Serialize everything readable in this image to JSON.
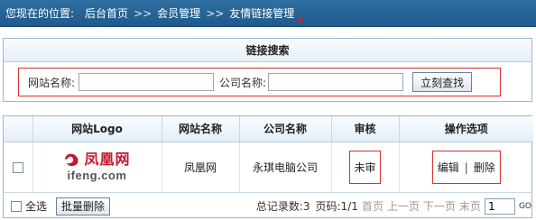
{
  "breadcrumb": {
    "prefix": "您现在的位置:",
    "items": [
      "后台首页",
      "会员管理",
      "友情链接管理"
    ],
    "separator": ">>"
  },
  "search": {
    "title": "链接搜索",
    "site_name_label": "网站名称:",
    "site_name_value": "",
    "company_label": "公司名称:",
    "company_value": "",
    "submit_label": "立刻查找"
  },
  "table": {
    "columns": [
      "网站Logo",
      "网站名称",
      "公司名称",
      "审核",
      "操作选项"
    ],
    "rows": [
      {
        "logo_cn": "凤凰网",
        "logo_en": "ifeng.com",
        "site_name": "凤凰网",
        "company": "永琪电脑公司",
        "audit": "未审",
        "edit_label": "编辑",
        "ops_separator": "|",
        "delete_label": "删除"
      }
    ]
  },
  "footer": {
    "select_all_label": "全选",
    "batch_delete_label": "批量删除",
    "total_records": "总记录数:3",
    "page_info": "页码:1/1",
    "first_page": "首页",
    "prev_page": "上一页",
    "next_page": "下一页",
    "last_page": "末页",
    "page_input_value": "1",
    "go_label": "GO"
  },
  "colors": {
    "header_bar": "#2f6fa2",
    "highlight_border": "#d93030",
    "logo_red": "#c2182b"
  }
}
